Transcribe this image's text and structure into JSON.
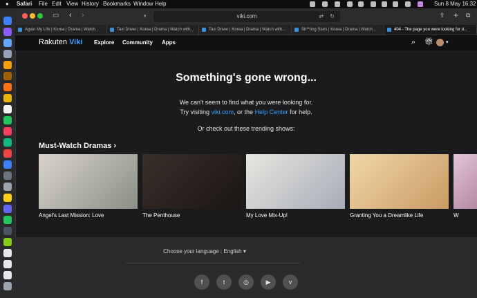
{
  "menubar": {
    "app": "Safari",
    "items": [
      "File",
      "Edit",
      "View",
      "History",
      "Bookmarks",
      "Window",
      "Help"
    ],
    "clock": "Sun 8 May  16:32"
  },
  "browser": {
    "url": "viki.com",
    "tabs": [
      "Again My Life | Korea | Drama | Watch...",
      "Taxi Driver | Korea | Drama | Watch with...",
      "Taxi Driver | Korea | Drama | Watch with...",
      "Sh**ting Stars | Korea | Drama | Watch...",
      "404 - The page you were looking for d..."
    ]
  },
  "viki": {
    "logo_brand": "Rakuten",
    "logo_name": "Viki",
    "nav": [
      "Explore",
      "Community",
      "Apps"
    ]
  },
  "main": {
    "headline": "Something's gone wrong...",
    "line1": "We can't seem to find what you were looking for.",
    "line2_pre": "Try visiting ",
    "line2_link1": "viki.com",
    "line2_mid": ", or the ",
    "line2_link2": "Help Center",
    "line2_post": " for help.",
    "line3": "Or check out these trending shows:",
    "trending_title": "Must-Watch Dramas",
    "trending_chevron": "›",
    "cards": [
      {
        "title": "Angel's Last Mission: Love",
        "colors": [
          "#d9d4cb",
          "#8a8f86"
        ]
      },
      {
        "title": "The Penthouse",
        "colors": [
          "#3a2e2a",
          "#1b1613"
        ]
      },
      {
        "title": "My Love Mix-Up!",
        "colors": [
          "#e8e6df",
          "#a6acb8"
        ]
      },
      {
        "title": "Granting You a Dreamlike Life",
        "colors": [
          "#f0d8a8",
          "#c99a62"
        ]
      },
      {
        "title": "W",
        "colors": [
          "#e3c4d8",
          "#b58aa3"
        ]
      }
    ]
  },
  "footer": {
    "language_label": "Choose your language : English",
    "social": [
      {
        "name": "facebook-icon",
        "glyph": "f"
      },
      {
        "name": "twitter-icon",
        "glyph": "t"
      },
      {
        "name": "instagram-icon",
        "glyph": "◎"
      },
      {
        "name": "youtube-icon",
        "glyph": "▶"
      },
      {
        "name": "viki-icon",
        "glyph": "v"
      }
    ]
  },
  "colors": {
    "accent": "#3ba0ff",
    "background": "#1b1b1d",
    "footer": "#2b2b2d"
  }
}
